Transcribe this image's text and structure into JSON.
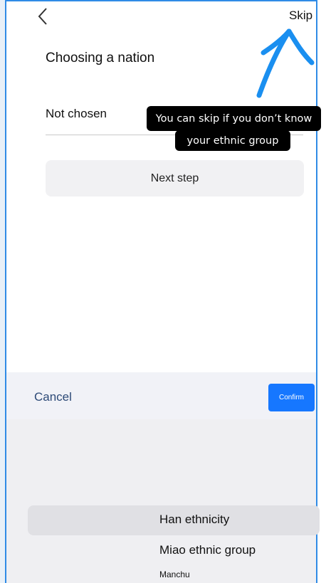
{
  "header": {
    "skip_label": "Skip"
  },
  "page": {
    "title": "Choosing a nation"
  },
  "selector": {
    "value": "Not chosen"
  },
  "next_button": {
    "label": "Next step"
  },
  "annotation": {
    "line1": "You can skip if you don’t know",
    "line2": "your ethnic group",
    "arrow_color": "#1a8ff0"
  },
  "sheet": {
    "cancel_label": "Cancel",
    "confirm_label": "Confirm",
    "confirm_color": "#1677ff"
  },
  "picker": {
    "options": [
      "Han ethnicity",
      "Miao ethnic group",
      "Manchu"
    ],
    "selected": "Han ethnicity"
  }
}
